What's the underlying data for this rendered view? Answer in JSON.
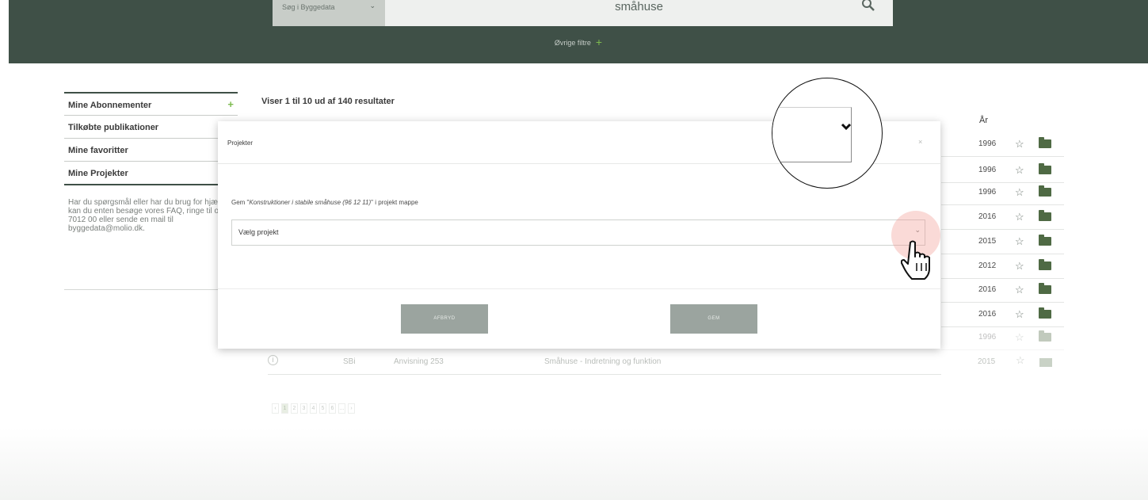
{
  "header": {
    "search_select_label": "Søg i Byggedata",
    "search_value": "småhuse",
    "filters_label": "Øvrige filtre",
    "filters_plus": "+"
  },
  "sidebar": {
    "items": [
      {
        "label": "Mine Abonnementer",
        "plus": "+"
      },
      {
        "label": "Tilkøbte publikationer"
      },
      {
        "label": "Mine favoritter"
      },
      {
        "label": "Mine Projekter"
      }
    ],
    "help_text": "Har du spørgsmål eller har du brug for hjælp, kan du enten besøge vores FAQ, ringe til os på 7012 00 eller sende en mail til byggedata@molio.dk."
  },
  "results": {
    "count_text": "Viser 1 til 10 ud af 140 resultater",
    "year_header": "År",
    "years": [
      "1996",
      "1996",
      "1996",
      "2016",
      "2015",
      "2012",
      "2016",
      "2016",
      "1996"
    ],
    "partial_row": {
      "info": "i",
      "type": "SBi",
      "series": "Anvisning 253",
      "title": "Småhuse - Indretning og funktion",
      "year": "2015"
    },
    "pages": [
      "‹",
      "1",
      "2",
      "3",
      "4",
      "5",
      "6",
      "...",
      "›"
    ]
  },
  "modal": {
    "title": "Projekter",
    "close": "×",
    "save_prefix": "Gem \"",
    "save_item": "Konstruktioner i stabile småhuse (96 12 11)",
    "save_suffix": "\" i projekt mappe",
    "select_placeholder": "Vælg projekt",
    "cancel_label": "AFBRYD",
    "save_label": "GEM"
  },
  "colors": {
    "header_bg": "#3f5047",
    "accent_green": "#7dbb4f",
    "button_bg": "#9ba49f",
    "click_highlight": "#f0968c"
  }
}
